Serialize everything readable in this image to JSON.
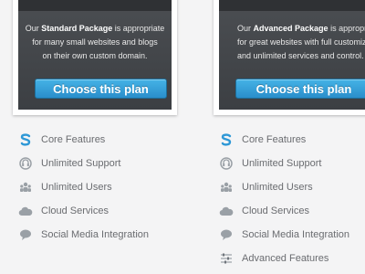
{
  "colors": {
    "accent": "#2f98d6",
    "icon": "#9aa0a6",
    "dark_panel": "#44474b"
  },
  "plans": [
    {
      "line1_pre": "Our ",
      "name": "Standard Package",
      "line1_post": " is appropriate",
      "line2": "for many small websites and blogs",
      "line3": "on their own custom domain.",
      "button": "Choose this plan"
    },
    {
      "line1_pre": "Our ",
      "name": "Advanced Package",
      "line1_post": " is appropriate",
      "line2": "for  great websites with full customization",
      "line3": "and unlimited services and control.",
      "button": "Choose this plan"
    }
  ],
  "features_left": [
    {
      "label": "Core Features",
      "icon": "s-logo-icon"
    },
    {
      "label": "Unlimited Support",
      "icon": "support-icon"
    },
    {
      "label": "Unlimited Users",
      "icon": "users-icon"
    },
    {
      "label": "Cloud Services",
      "icon": "cloud-icon"
    },
    {
      "label": "Social Media Integration",
      "icon": "chat-bubble-icon"
    }
  ],
  "features_right": [
    {
      "label": "Core Features",
      "icon": "s-logo-icon"
    },
    {
      "label": "Unlimited Support",
      "icon": "support-icon"
    },
    {
      "label": "Unlimited Users",
      "icon": "users-icon"
    },
    {
      "label": "Cloud Services",
      "icon": "cloud-icon"
    },
    {
      "label": "Social Media Integration",
      "icon": "chat-bubble-icon"
    },
    {
      "label": "Advanced Features",
      "icon": "settings-sliders-icon"
    }
  ]
}
